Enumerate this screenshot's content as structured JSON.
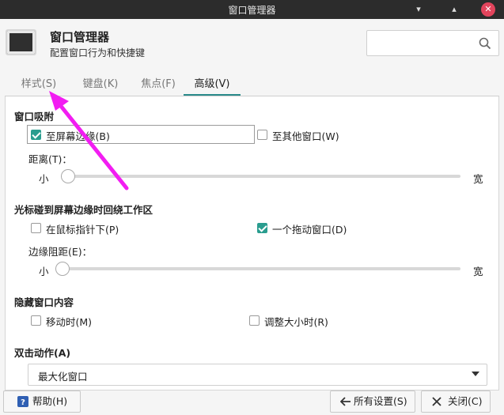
{
  "window": {
    "title": "窗口管理器",
    "controls": [
      "minimize-icon",
      "maximize-icon",
      "close-icon"
    ]
  },
  "header": {
    "title": "窗口管理器",
    "subtitle": "配置窗口行为和快捷键",
    "search_placeholder": ""
  },
  "tabs": [
    {
      "label": "样式(S)",
      "active": false
    },
    {
      "label": "键盘(K)",
      "active": false
    },
    {
      "label": "焦点(F)",
      "active": false
    },
    {
      "label": "高级(V)",
      "active": true
    }
  ],
  "snap": {
    "heading": "窗口吸附",
    "to_screen_edges": {
      "label": "至屏幕边缘(B)",
      "checked": true
    },
    "to_other_windows": {
      "label": "至其他窗口(W)",
      "checked": false
    },
    "distance_label": "距离(T)：",
    "min_label": "小",
    "max_label": "宽",
    "distance_value": 0.0
  },
  "wrap": {
    "heading": "光标碰到屏幕边缘时回绕工作区",
    "under_pointer": {
      "label": "在鼠标指针下(P)",
      "checked": false
    },
    "drag_window": {
      "label": "一个拖动窗口(D)",
      "checked": true
    },
    "resistance_label": "边缘阻距(E)：",
    "min_label": "小",
    "max_label": "宽",
    "resistance_value": 0.0
  },
  "hide_content": {
    "heading": "隐藏窗口内容",
    "while_moving": {
      "label": "移动时(M)",
      "checked": false
    },
    "while_resizing": {
      "label": "调整大小时(R)",
      "checked": false
    }
  },
  "double_click": {
    "heading": "双击动作(A)",
    "selected": "最大化窗口"
  },
  "footer": {
    "help": "帮助(H)",
    "all_settings": "所有设置(S)",
    "close": "关闭(C)"
  },
  "annotation_color": "#f21df2",
  "accent_color": "#2a9d8f"
}
